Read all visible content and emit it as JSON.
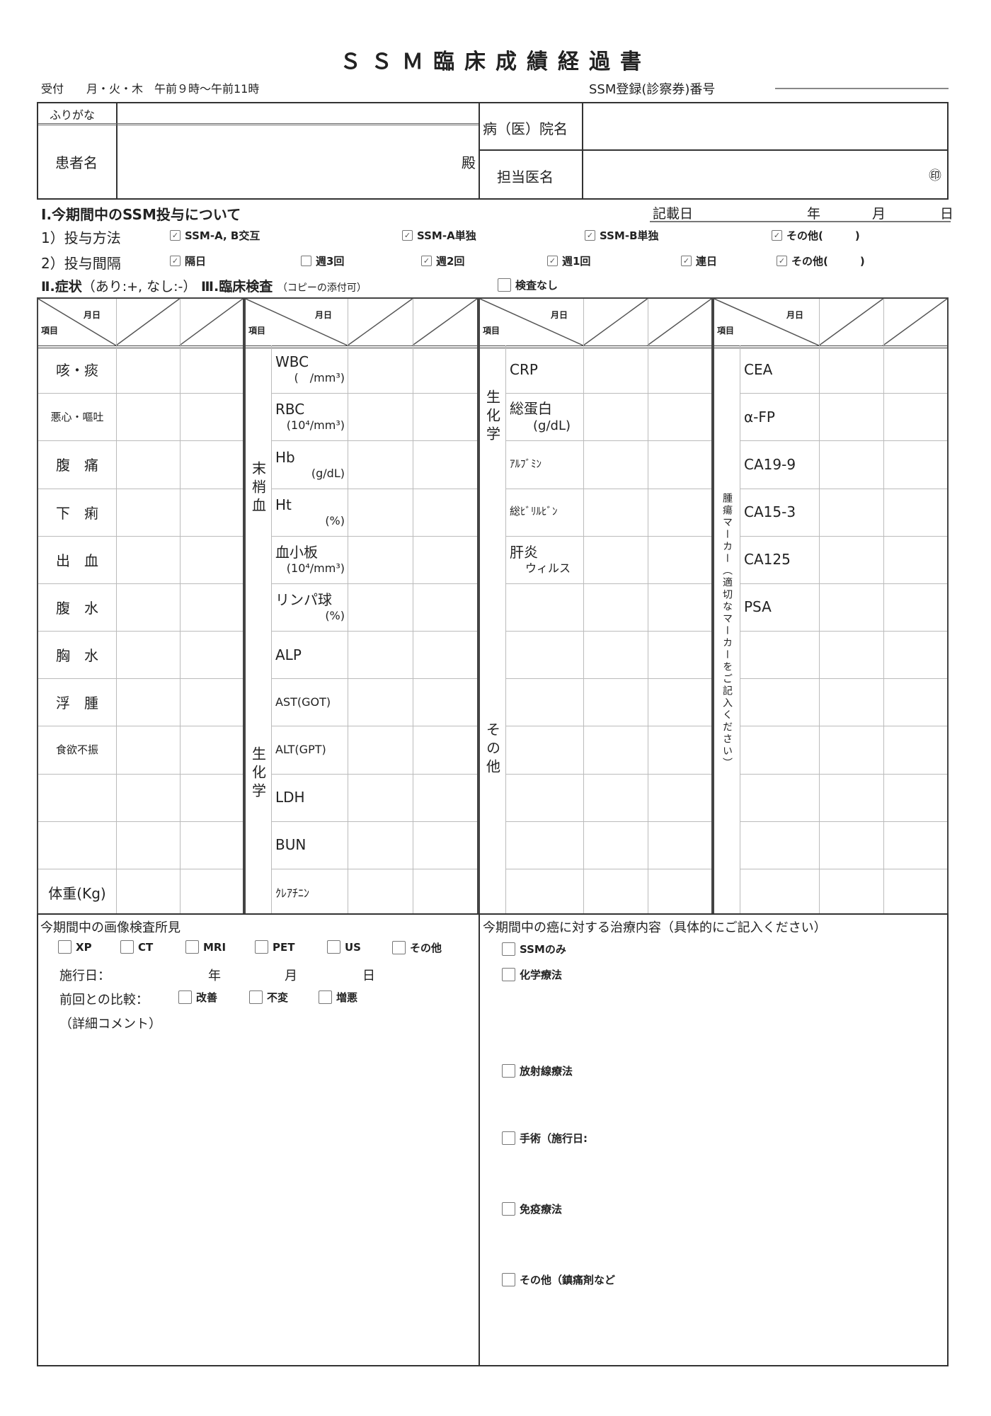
{
  "title": "ＳＳＭ臨床成績経過書",
  "reception": "受付　　月・火・木　午前９時～午前11時",
  "registration_label": "SSM登録(診察券)番号",
  "header": {
    "furigana_label": "ふりがな",
    "patient_label": "患者名",
    "patient_suffix": "殿",
    "hospital_label": "病（医）院名",
    "doctor_label": "担当医名",
    "seal": "㊞"
  },
  "section1": {
    "title": "Ⅰ.今期間中のSSM投与について",
    "date_label": "記載日",
    "year": "年",
    "month": "月",
    "day": "日",
    "method_label": "1）投与方法",
    "methods": [
      {
        "label": "SSM-A, B交互",
        "checked": true
      },
      {
        "label": "SSM-A単独",
        "checked": true
      },
      {
        "label": "SSM-B単独",
        "checked": true
      },
      {
        "label": "その他(　　　)",
        "checked": true
      }
    ],
    "interval_label": "2）投与間隔",
    "intervals": [
      {
        "label": "隔日",
        "checked": true
      },
      {
        "label": "週3回",
        "checked": false
      },
      {
        "label": "週2回",
        "checked": true
      },
      {
        "label": "週1回",
        "checked": true
      },
      {
        "label": "連日",
        "checked": true
      },
      {
        "label": "その他(　　　)",
        "checked": true
      }
    ]
  },
  "section2": {
    "symptoms_title": "Ⅱ.症状",
    "symptoms_note": "（あり:+, なし:-）",
    "lab_title": "Ⅲ.臨床検査",
    "lab_note": "（コピーの添付可）",
    "no_test_label": "検査なし",
    "no_test_checked": false
  },
  "grid": {
    "header_item": "項目",
    "header_date": "月日",
    "symptoms": [
      "咳・痰",
      "悪心・嘔吐",
      "腹　痛",
      "下　痢",
      "出　血",
      "腹　水",
      "胸　水",
      "浮　腫",
      "食欲不振",
      "",
      "",
      "体重(Kg)"
    ],
    "blood_group": "末梢血",
    "blood_items": [
      {
        "name": "WBC",
        "unit": "(　/mm³)"
      },
      {
        "name": "RBC",
        "unit": "(10⁴/mm³)"
      },
      {
        "name": "Hb",
        "unit": "(g/dL)"
      },
      {
        "name": "Ht",
        "unit": "(%)"
      },
      {
        "name": "血小板",
        "unit": "(10⁴/mm³)"
      },
      {
        "name": "リンパ球",
        "unit": "(%)"
      }
    ],
    "chem_group_1": "生化学",
    "chem_items_1": [
      "ALP",
      "AST(GOT)",
      "ALT(GPT)",
      "LDH",
      "BUN",
      "ｸﾚｱﾁﾆﾝ"
    ],
    "chem_group_2": "生化学",
    "chem_items_2": [
      {
        "name": "CRP",
        "unit": ""
      },
      {
        "name": "総蛋白",
        "unit": "(g/dL)"
      },
      {
        "name": "ｱﾙﾌﾞﾐﾝ",
        "unit": ""
      },
      {
        "name": "総ﾋﾞﾘﾙﾋﾞﾝ",
        "unit": ""
      },
      {
        "name": "肝炎",
        "unit": "ウィルス"
      }
    ],
    "other_group": "その他",
    "tumor_group": "腫瘍マーカー（適切なマーカーをご記入ください）",
    "tumor_items": [
      "CEA",
      "α-FP",
      "CA19-9",
      "CA15-3",
      "CA125",
      "PSA"
    ]
  },
  "imaging": {
    "title": "今期間中の画像検査所見",
    "types": [
      {
        "label": "XP",
        "checked": false
      },
      {
        "label": "CT",
        "checked": false
      },
      {
        "label": "MRI",
        "checked": false
      },
      {
        "label": "PET",
        "checked": false
      },
      {
        "label": "US",
        "checked": false
      },
      {
        "label": "その他",
        "checked": false
      }
    ],
    "date_label": "施行日：",
    "year": "年",
    "month": "月",
    "day": "日",
    "comparison_label": "前回との比較：",
    "comparisons": [
      {
        "label": "改善",
        "checked": false
      },
      {
        "label": "不変",
        "checked": false
      },
      {
        "label": "増悪",
        "checked": false
      }
    ],
    "comment_label": "（詳細コメント）"
  },
  "treatment": {
    "title": "今期間中の癌に対する治療内容（具体的にご記入ください）",
    "options": [
      {
        "label": "SSMのみ",
        "checked": false
      },
      {
        "label": "化学療法",
        "checked": false
      },
      {
        "label": "放射線療法",
        "checked": false
      },
      {
        "label": "手術（施行日:",
        "checked": false
      },
      {
        "label": "免疫療法",
        "checked": false
      },
      {
        "label": "その他（鎮痛剤など",
        "checked": false
      }
    ]
  }
}
